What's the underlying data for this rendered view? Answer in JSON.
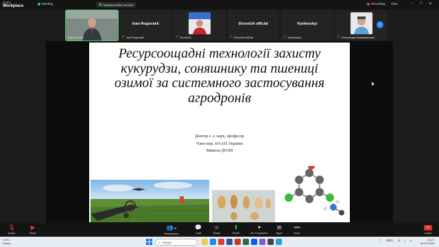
{
  "window": {
    "brand_line1": "zoom",
    "brand_line2": "Workplace",
    "meeting_label": "Meeting",
    "screen_share_label": "Mykola Dolia's screen",
    "recording_label": "Recording",
    "view_label": "View"
  },
  "participants": [
    {
      "name": "Mykola Dolia",
      "center_name": "",
      "video": true,
      "muted": false,
      "active": true
    },
    {
      "name": "Ivan Rogovskii",
      "center_name": "Ivan Rogovskii",
      "video": false,
      "muted": true,
      "active": false
    },
    {
      "name": "DroneUA",
      "center_name": "",
      "video": true,
      "muted": true,
      "active": false
    },
    {
      "name": "DroneUA official",
      "center_name": "DroneUA official",
      "video": false,
      "muted": true,
      "active": false
    },
    {
      "name": "Vyshevskyi",
      "center_name": "Vyshevskyi",
      "video": false,
      "muted": true,
      "active": false
    },
    {
      "name": "Олександр Макаревський",
      "center_name": "",
      "video": true,
      "muted": true,
      "active": false
    }
  ],
  "slide": {
    "title": "Ресурсоощадні технології захисту кукурудзи, соняшнику та пшениці озимої за системного застосування агродронів",
    "author_line1": "Доктор с.-г. наук, професор",
    "author_line2": "Член-кор. НААН України",
    "author_line3": "Микола ДОЛЯ"
  },
  "toolbar": {
    "audio": "Audio",
    "video": "Video",
    "participants": "Participants",
    "participants_count": "98",
    "chat": "Chat",
    "react": "React",
    "share": "Share",
    "ai_companion": "AI Companion",
    "apps": "Apps",
    "more": "More",
    "leave": "Leave"
  },
  "taskbar": {
    "weather_temp": "+13°C",
    "weather_desc": "Cloudy",
    "search_placeholder": "Пошук",
    "lang": "ENG",
    "time": "10:27",
    "date": "30.10.2024"
  }
}
